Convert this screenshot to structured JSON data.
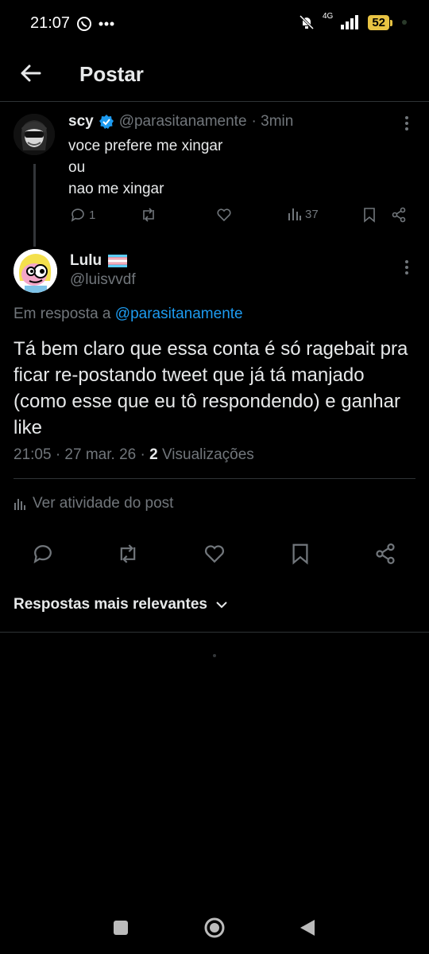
{
  "status_bar": {
    "time": "21:07",
    "network": "4G",
    "battery": "52"
  },
  "header": {
    "title": "Postar"
  },
  "parent_tweet": {
    "name": "scy",
    "handle": "@parasitanamente",
    "age": "· 3min",
    "lines": [
      "voce prefere me xingar",
      "ou",
      "nao me xingar"
    ],
    "replies": "1",
    "views": "37"
  },
  "main_tweet": {
    "name": "Lulu",
    "handle": "@luisvvdf",
    "reply_prefix": "Em resposta a",
    "reply_handle": "@parasitanamente",
    "text": "Tá bem claro que essa conta é só ragebait pra ficar re-postando tweet que já tá manjado (como esse que eu tô respondendo) e ganhar like",
    "timestamp": "21:05 · 27 mar. 26 ·",
    "view_count": "2",
    "views_label": "Visualizações",
    "activity_label": "Ver atividade do post"
  },
  "replies_section": {
    "sort_label": "Respostas mais relevantes"
  },
  "colors": {
    "accent": "#1d9bf0",
    "muted": "#71767b",
    "text": "#e7e9ea",
    "battery": "#e8c343"
  }
}
